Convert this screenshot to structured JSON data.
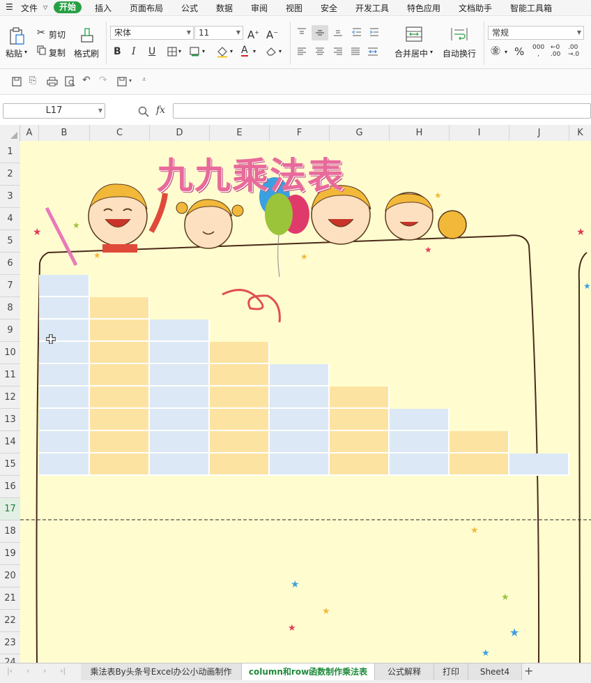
{
  "menubar": {
    "hamburger": "☰",
    "file": "文件",
    "items": [
      "开始",
      "插入",
      "页面布局",
      "公式",
      "数据",
      "审阅",
      "视图",
      "安全",
      "开发工具",
      "特色应用",
      "文档助手",
      "智能工具箱"
    ]
  },
  "ribbon": {
    "paste": "粘贴",
    "cut": "剪切",
    "copy": "复制",
    "format_painter": "格式刷",
    "font_name": "宋体",
    "font_size": "11",
    "merge_center": "合并居中",
    "wrap_text": "自动换行",
    "number_format": "常规",
    "percent": "%",
    "thousands": "000"
  },
  "formulabar": {
    "cell_ref": "L17",
    "fx": "fx",
    "formula": ""
  },
  "columns": [
    "A",
    "B",
    "C",
    "D",
    "E",
    "F",
    "G",
    "H",
    "I",
    "J",
    "K"
  ],
  "rows": [
    "1",
    "2",
    "3",
    "4",
    "5",
    "6",
    "7",
    "8",
    "9",
    "10",
    "11",
    "12",
    "13",
    "14",
    "15",
    "16",
    "17",
    "18",
    "19",
    "20",
    "21",
    "22",
    "23",
    "24"
  ],
  "selected_row": "17",
  "sheet": {
    "banner_title": "九九乘法表",
    "colors": {
      "blue_cell": "#dce8f5",
      "orange_cell": "#fde3a1",
      "background": "#fffdd0"
    }
  },
  "tabs": [
    "乘法表By头条号Excel办公小动画制作",
    "column和row函数制作乘法表",
    "公式解释",
    "打印",
    "Sheet4"
  ],
  "active_tab": "column和row函数制作乘法表",
  "add_tab": "+"
}
